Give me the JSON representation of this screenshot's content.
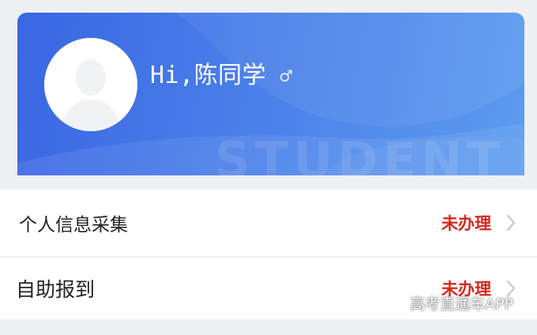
{
  "profile": {
    "greeting": "Hi,陈同学",
    "gender_symbol": "♂",
    "background_word": "STUDENT"
  },
  "menu": [
    {
      "label": "个人信息采集",
      "status": "未办理"
    },
    {
      "label": "自助报到",
      "status": "未办理"
    }
  ],
  "source_watermark": "高考直通车APP",
  "colors": {
    "card_start": "#3a66e3",
    "card_end": "#5c9bef",
    "status_red": "#d9261c",
    "page_bg": "#eef0f3"
  },
  "icons": {
    "avatar": "person-silhouette-icon",
    "gender": "male-icon",
    "chevron": "chevron-right-icon"
  }
}
